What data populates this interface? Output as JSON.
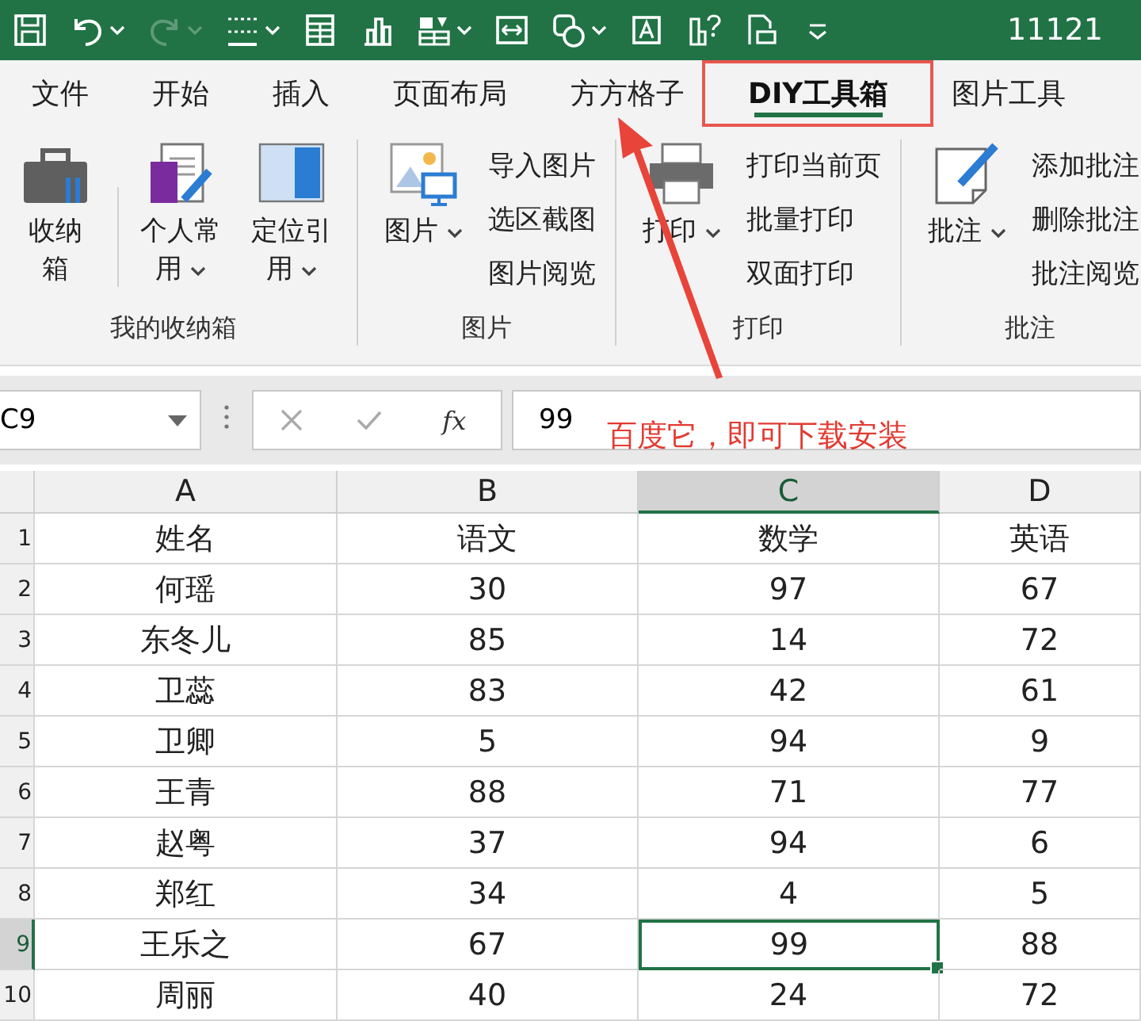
{
  "title_bar": {
    "title": "11121"
  },
  "tabs": [
    {
      "label": "文件",
      "selected": false
    },
    {
      "label": "开始",
      "selected": false
    },
    {
      "label": "插入",
      "selected": false
    },
    {
      "label": "页面布局",
      "selected": false
    },
    {
      "label": "方方格子",
      "selected": false
    },
    {
      "label": "DIY工具箱",
      "selected": true
    },
    {
      "label": "图片工具",
      "selected": false
    }
  ],
  "ribbon_groups": [
    {
      "label": "我的收纳箱",
      "large_buttons": [
        {
          "label": "收纳箱",
          "kind": "briefcase",
          "dropdown": false
        },
        {
          "label": "个人常用",
          "kind": "document",
          "dropdown": true
        },
        {
          "label": "定位引用",
          "kind": "panel",
          "dropdown": true
        }
      ]
    },
    {
      "label": "图片",
      "large_buttons": [
        {
          "label": "图片",
          "kind": "picture",
          "dropdown": true
        }
      ],
      "small_buttons": [
        "导入图片",
        "选区截图",
        "图片阅览"
      ]
    },
    {
      "label": "打印",
      "large_buttons": [
        {
          "label": "打印",
          "kind": "printer",
          "dropdown": true
        }
      ],
      "small_buttons": [
        "打印当前页",
        "批量打印",
        "双面打印"
      ]
    },
    {
      "label": "批注",
      "large_buttons": [
        {
          "label": "批注",
          "kind": "note",
          "dropdown": true
        }
      ],
      "small_buttons": [
        "添加批注",
        "删除批注",
        "批注阅览"
      ]
    }
  ],
  "formula_bar": {
    "name_box": "C9",
    "function_label": "fx",
    "value": "99"
  },
  "sheet": {
    "columns": [
      {
        "label": "A",
        "selected": false
      },
      {
        "label": "B",
        "selected": false
      },
      {
        "label": "C",
        "selected": true
      },
      {
        "label": "D",
        "selected": false
      }
    ],
    "rows": [
      {
        "number": "1",
        "selected": false,
        "cells": [
          "姓名",
          "语文",
          "数学",
          "英语"
        ]
      },
      {
        "number": "2",
        "selected": false,
        "cells": [
          "何瑶",
          "30",
          "97",
          "67"
        ]
      },
      {
        "number": "3",
        "selected": false,
        "cells": [
          "东冬儿",
          "85",
          "14",
          "72"
        ]
      },
      {
        "number": "4",
        "selected": false,
        "cells": [
          "卫蕊",
          "83",
          "42",
          "61"
        ]
      },
      {
        "number": "5",
        "selected": false,
        "cells": [
          "卫卿",
          "5",
          "94",
          "9"
        ]
      },
      {
        "number": "6",
        "selected": false,
        "cells": [
          "王青",
          "88",
          "71",
          "77"
        ]
      },
      {
        "number": "7",
        "selected": false,
        "cells": [
          "赵粤",
          "37",
          "94",
          "6"
        ]
      },
      {
        "number": "8",
        "selected": false,
        "cells": [
          "郑红",
          "34",
          "4",
          "5"
        ]
      },
      {
        "number": "9",
        "selected": true,
        "cells": [
          "王乐之",
          "67",
          "99",
          "88"
        ]
      },
      {
        "number": "10",
        "selected": false,
        "cells": [
          "周丽",
          "40",
          "24",
          "72"
        ]
      }
    ]
  },
  "annotation": {
    "text": "百度它，即可下载安装"
  }
}
